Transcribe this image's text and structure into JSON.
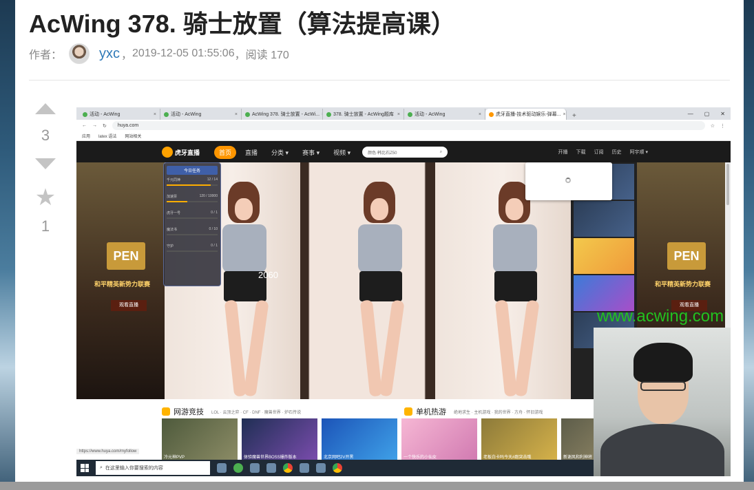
{
  "article": {
    "title": "AcWing 378. 骑士放置（算法提高课）",
    "author_label": "作者：",
    "author_name": "yxc",
    "sep1": "，",
    "date": "2019-12-05 01:55:06",
    "sep2": "，",
    "reads": "阅读 170"
  },
  "votes": {
    "up_icon": "triangle-up-icon",
    "count": "3",
    "down_icon": "triangle-down-icon",
    "star_icon": "star-icon",
    "star_count": "1"
  },
  "video": {
    "browser_tabs": [
      {
        "label": "活动 - AcWing"
      },
      {
        "label": "活动 - AcWing"
      },
      {
        "label": "AcWing 378. 骑士放置 - AcWi..."
      },
      {
        "label": "378. 骑士放置 - AcWing题库"
      },
      {
        "label": "活动 - AcWing"
      },
      {
        "label": "虎牙直播-技术驱动娱乐-弹幕..."
      }
    ],
    "new_tab": "+",
    "address_url": "huya.com",
    "bookmarks": [
      "应用",
      "latex 语法",
      "网站相关"
    ],
    "huya": {
      "logo": "虎牙直播",
      "nav": [
        "首页",
        "直播",
        "分类 ▾",
        "赛事 ▾",
        "视频 ▾"
      ],
      "search_placeholder": "颜色·韩比石Z50",
      "right_nav": [
        "开播",
        "下载",
        "订阅",
        "历史",
        "阿宇顺 ▾"
      ],
      "banner_pen": "PEN",
      "banner_promo": "和平精英新势力联赛",
      "banner_watch": "观看直播",
      "task_panel_title": "今日任务",
      "task_items": [
        {
          "label": "千元同神",
          "value": "12 / 14",
          "progress": 0.86
        },
        {
          "label": "加速票",
          "value": "120 / 10000",
          "progress": 0.4
        },
        {
          "label": "虎牙一号",
          "value": "0 / 1",
          "progress": 0
        },
        {
          "label": "魔法书",
          "value": "0 / 10",
          "progress": 0
        },
        {
          "label": "守护",
          "value": "0 / 1",
          "progress": 0
        }
      ],
      "overlay_number": "2060",
      "section_online": "网游竞技",
      "section_online_subs": "LOL  · 云顶之弈 · CF · DNF · 魔兽世界 · 炉石传说",
      "section_single": "单机热游",
      "section_single_subs": "绝地求生 · 主机游戏 · 我的世界 · 方舟 · 怀旧游戏",
      "thumbs": [
        {
          "caption": "冷元神PVP"
        },
        {
          "caption": "体验魔兽世界BOSS爆炸版本"
        },
        {
          "caption": "北京网吧2V开黑"
        },
        {
          "caption": "一个快乐的小仙女"
        },
        {
          "caption": "老板白卡吗今天#跑突击哦"
        },
        {
          "caption": "新谢风和利神将"
        }
      ],
      "status_url": "https://www.huya.com/myfollow"
    },
    "watermark": "www.acwing.com",
    "taskbar_search": "在这里输入你要搜索的内容"
  }
}
